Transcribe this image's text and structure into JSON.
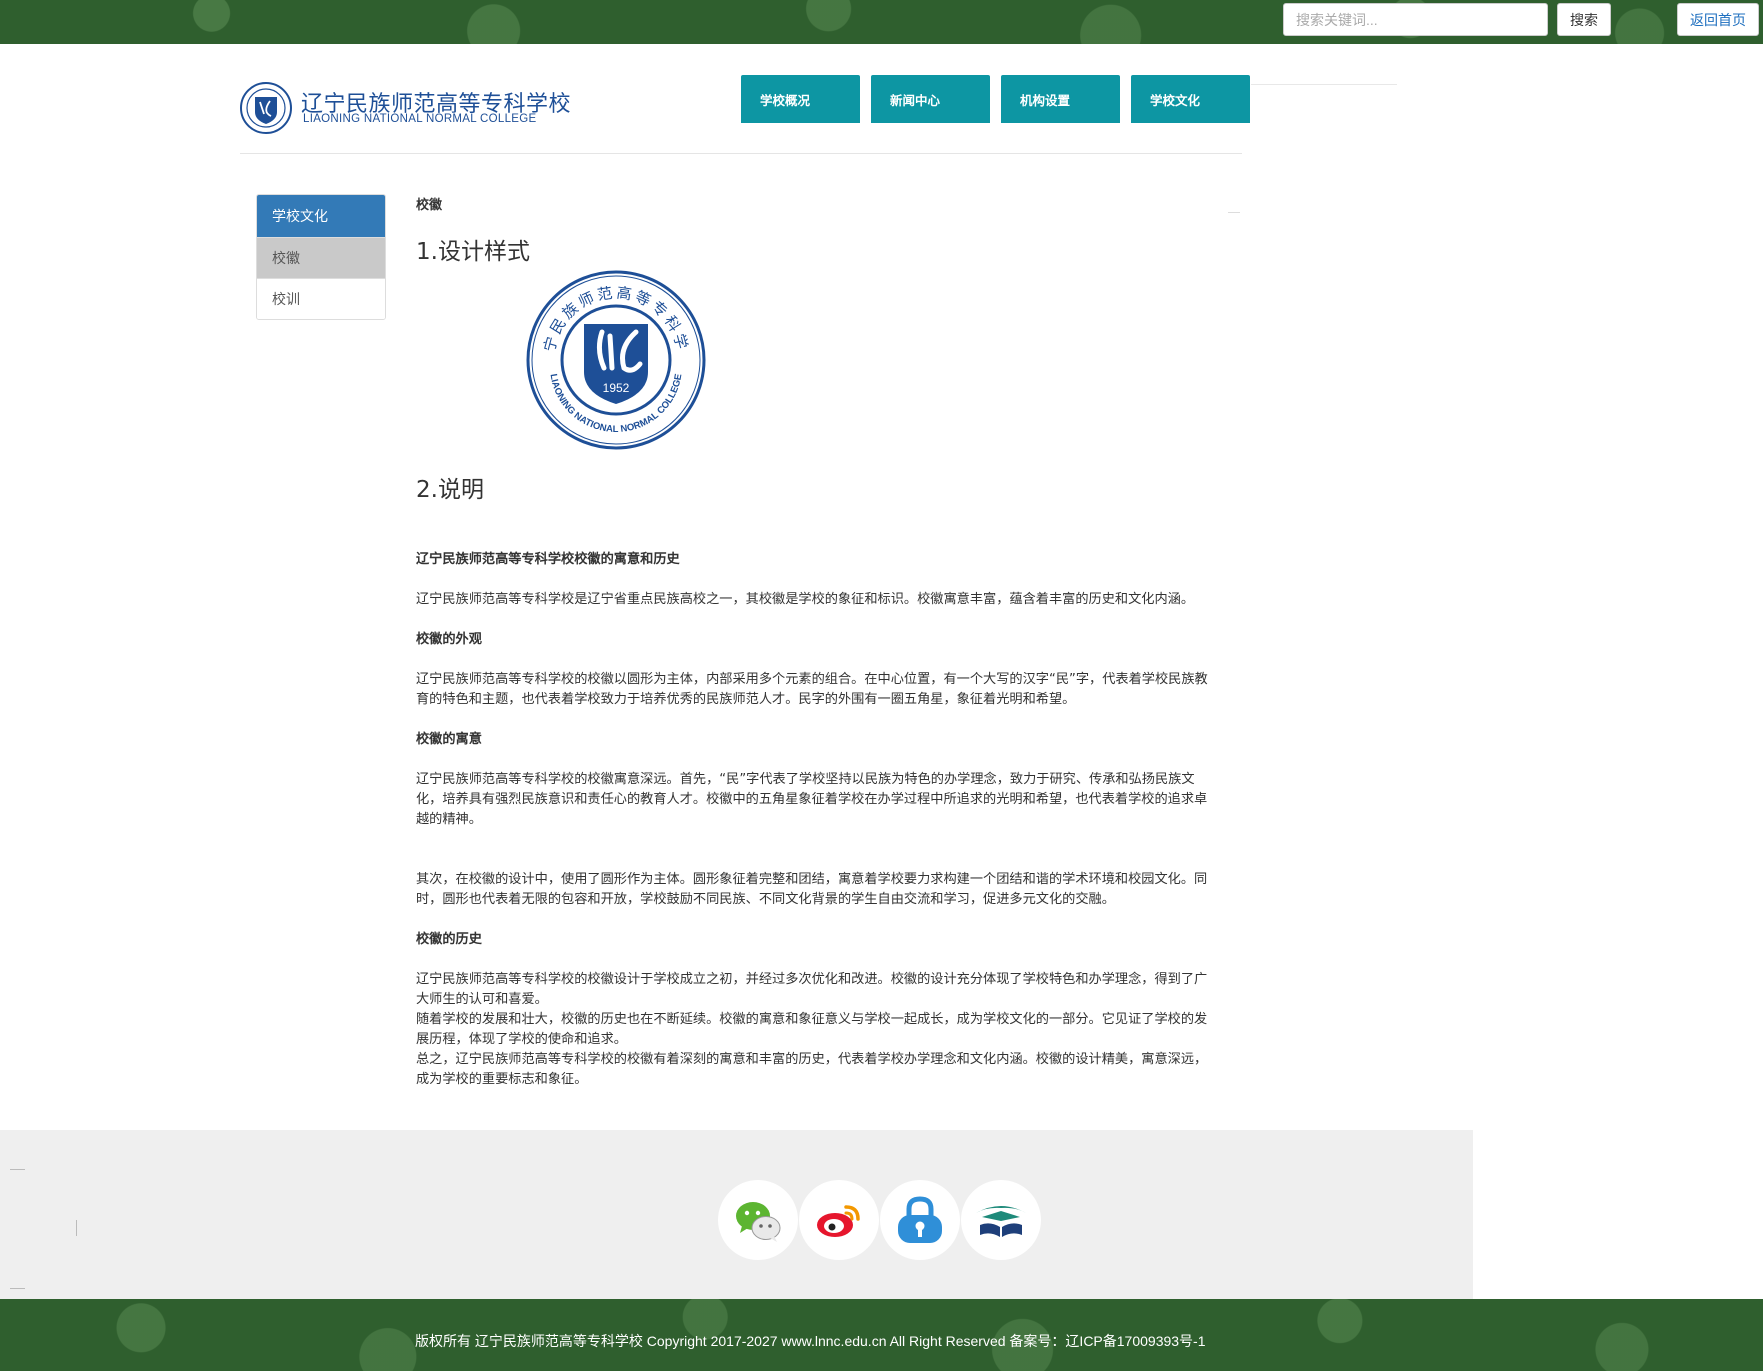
{
  "topbar": {
    "search_placeholder": "搜索关键词...",
    "search_button": "搜索",
    "home_button": "返回首页"
  },
  "header": {
    "school_name_cn": "辽宁民族师范高等专科学校",
    "school_name_en": "LIAONING NATIONAL NORMAL COLLEGE",
    "nav": [
      "学校概况",
      "新闻中心",
      "机构设置",
      "学校文化"
    ]
  },
  "sidebar": {
    "title": "学校文化",
    "items": [
      "校徽",
      "校训"
    ]
  },
  "main": {
    "breadcrumb": "校徽",
    "heading_design": "1.设计样式",
    "heading_desc": "2.说明",
    "emblem": {
      "year": "1952",
      "ring_text_cn": "辽宁民族师范高等专科学校",
      "ring_text_en": "LIAONING NATIONAL NORMAL COLLEGE"
    },
    "article": [
      {
        "type": "sub",
        "text": "辽宁民族师范高等专科学校校徽的寓意和历史"
      },
      {
        "type": "p",
        "text": "辽宁民族师范高等专科学校是辽宁省重点民族高校之一，其校徽是学校的象征和标识。校徽寓意丰富，蕴含着丰富的历史和文化内涵。"
      },
      {
        "type": "sub",
        "text": "校徽的外观"
      },
      {
        "type": "p",
        "text": "辽宁民族师范高等专科学校的校徽以圆形为主体，内部采用多个元素的组合。在中心位置，有一个大写的汉字“民”字，代表着学校民族教育的特色和主题，也代表着学校致力于培养优秀的民族师范人才。民字的外围有一圈五角星，象征着光明和希望。"
      },
      {
        "type": "sub",
        "text": "校徽的寓意"
      },
      {
        "type": "p",
        "text": "辽宁民族师范高等专科学校的校徽寓意深远。首先，“民”字代表了学校坚持以民族为特色的办学理念，致力于研究、传承和弘扬民族文化，培养具有强烈民族意识和责任心的教育人才。校徽中的五角星象征着学校在办学过程中所追求的光明和希望，也代表着学校的追求卓越的精神。"
      },
      {
        "type": "p",
        "text": "其次，在校徽的设计中，使用了圆形作为主体。圆形象征着完整和团结，寓意着学校要力求构建一个团结和谐的学术环境和校园文化。同时，圆形也代表着无限的包容和开放，学校鼓励不同民族、不同文化背景的学生自由交流和学习，促进多元文化的交融。"
      },
      {
        "type": "sub",
        "text": "校徽的历史"
      },
      {
        "type": "p",
        "text": "辽宁民族师范高等专科学校的校徽设计于学校成立之初，并经过多次优化和改进。校徽的设计充分体现了学校特色和办学理念，得到了广大师生的认可和喜爱。"
      },
      {
        "type": "p",
        "text": "随着学校的发展和壮大，校徽的历史也在不断延续。校徽的寓意和象征意义与学校一起成长，成为学校文化的一部分。它见证了学校的发展历程，体现了学校的使命和追求。"
      },
      {
        "type": "p",
        "text": "总之，辽宁民族师范高等专科学校的校徽有着深刻的寓意和丰富的历史，代表着学校办学理念和文化内涵。校徽的设计精美，寓意深远，成为学校的重要标志和象征。"
      }
    ]
  },
  "footer": {
    "social_icons": [
      "wechat-icon",
      "weibo-icon",
      "lock-icon",
      "book-pavilion-icon"
    ],
    "copyright": "版权所有 辽宁民族师范高等专科学校 Copyright 2017-2027 www.lnnc.edu.cn All Right Reserved 备案号：辽ICP备17009393号-1"
  },
  "colors": {
    "forest_green": "#2f5f2e",
    "nav_teal": "#0d96a3",
    "sidebar_blue": "#337ab7",
    "brand_blue": "#1e4f97"
  }
}
